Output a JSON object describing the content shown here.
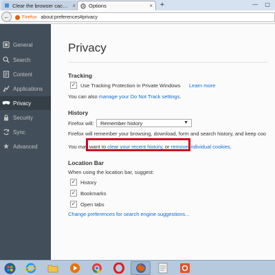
{
  "browser": {
    "tabs": [
      {
        "label": "Clear the browser cache - in",
        "active": false
      },
      {
        "label": "Options",
        "active": true
      }
    ],
    "new_tab_symbol": "+",
    "window_controls": [
      "—",
      "▢"
    ],
    "back_symbol": "←",
    "url_brand": "Firefox",
    "url": "about:preferences#privacy"
  },
  "sidebar": {
    "items": [
      {
        "label": "General",
        "icon": "general-icon",
        "selected": false
      },
      {
        "label": "Search",
        "icon": "search-icon",
        "selected": false
      },
      {
        "label": "Content",
        "icon": "content-icon",
        "selected": false
      },
      {
        "label": "Applications",
        "icon": "applications-icon",
        "selected": false
      },
      {
        "label": "Privacy",
        "icon": "privacy-mask-icon",
        "selected": true
      },
      {
        "label": "Security",
        "icon": "security-lock-icon",
        "selected": false
      },
      {
        "label": "Sync",
        "icon": "sync-icon",
        "selected": false
      },
      {
        "label": "Advanced",
        "icon": "advanced-wizard-icon",
        "selected": false
      }
    ]
  },
  "main": {
    "title": "Privacy",
    "tracking": {
      "heading": "Tracking",
      "checkbox_label": "Use Tracking Protection in Private Windows",
      "checked": true,
      "learn_more": "Learn more",
      "dnt_prefix": "You can also",
      "dnt_link": "manage your Do Not Track settings",
      "dnt_suffix": "."
    },
    "history": {
      "heading": "History",
      "will_label": "Firefox will:",
      "will_value": "Remember history",
      "description": "Firefox will remember your browsing, download, form and search history, and keep coo",
      "clear_prefix": "You may want to",
      "clear_link": "clear your recent history",
      "clear_mid": ", or",
      "remove_link": "remove individual cookies",
      "clear_suffix": "."
    },
    "location_bar": {
      "heading": "Location Bar",
      "suggest_label": "When using the location bar, suggest:",
      "options": [
        {
          "label": "History",
          "checked": true
        },
        {
          "label": "Bookmarks",
          "checked": true
        },
        {
          "label": "Open tabs",
          "checked": true
        }
      ],
      "change_link": "Change preferences for search engine suggestions..."
    }
  },
  "taskbar": {
    "items": [
      "start-orb-icon",
      "internet-explorer-icon",
      "file-explorer-icon",
      "media-player-icon",
      "chrome-icon",
      "opera-icon",
      "firefox-icon",
      "notes-icon",
      "photo-app-icon"
    ]
  },
  "colors": {
    "sidebar_bg": "#424f5a",
    "sidebar_selected": "#343f48",
    "link": "#0c6ecf",
    "highlight_box": "#d0021b"
  }
}
